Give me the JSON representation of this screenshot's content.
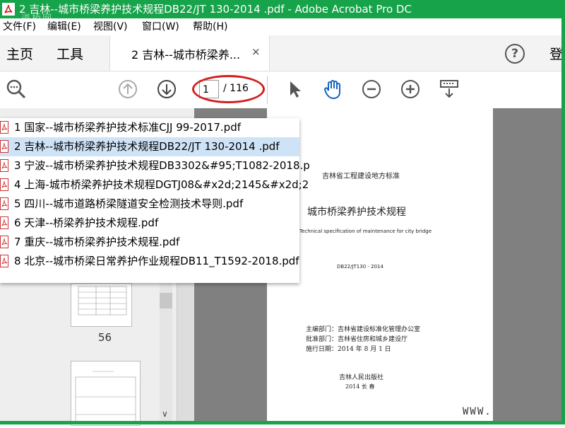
{
  "window": {
    "title": "2 吉林--城市桥梁养护技术规程DB22/JT 130-2014 .pdf - Adobe Acrobat Pro DC",
    "watermark": "道桥网"
  },
  "menu": {
    "items": [
      "文件(F)",
      "编辑(E)",
      "视图(V)",
      "窗口(W)",
      "帮助(H)"
    ]
  },
  "tabs": {
    "home": "主页",
    "tools": "工具",
    "doc": "2 吉林--城市桥梁养...",
    "close": "×",
    "help": "?",
    "login": "登"
  },
  "toolbar": {
    "page_current": "1",
    "page_total": "/ 116"
  },
  "files": [
    "1 国家--城市桥梁养护技术标准CJJ 99-2017.pdf",
    "2 吉林--城市桥梁养护技术规程DB22/JT 130-2014 .pdf",
    "3 宁波--城市桥梁养护技术规程DB3302&#95;T1082-2018.p",
    "4 上海-城市桥梁养护技术规程DGTJ08&#x2d;2145&#x2d;2",
    "5 四川--城市道路桥梁隧道安全检测技术导则.pdf",
    "6 天津--桥梁养护技术规程.pdf",
    "7 重庆--城市桥梁养护技术规程.pdf",
    "8 北京--城市桥梁日常养护作业规程DB11_T1592-2018.pdf"
  ],
  "thumbnails": {
    "page_number": "56"
  },
  "document": {
    "header": "吉林省工程建设地方标准",
    "title_cn": "城市桥梁养护技术规程",
    "title_en": "Technical specification of maintenance for city bridge",
    "code": "DB22/JT130 - 2014",
    "editor": "主编部门：吉林省建设标准化管理办公室",
    "approver": "批准部门：吉林省住房和城乡建设厅",
    "date": "施行日期：2014 年 8 月 1 日",
    "publisher": "吉林人民出版社",
    "pub_place": "2014  长 春",
    "watermark": "WWW."
  },
  "colors": {
    "accent": "#16a34a",
    "selection": "#cfe3f7",
    "highlight_ring": "#d21f1f"
  }
}
